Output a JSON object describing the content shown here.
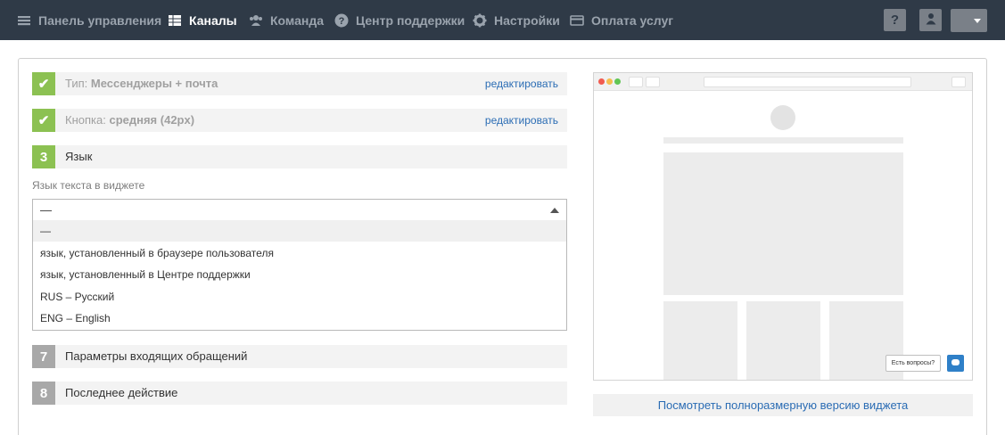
{
  "nav": {
    "items": [
      {
        "label": "Панель управления",
        "icon": "dashboard-icon",
        "active": false
      },
      {
        "label": "Каналы",
        "icon": "channels-icon",
        "active": true
      },
      {
        "label": "Команда",
        "icon": "team-icon",
        "active": false
      },
      {
        "label": "Центр поддержки",
        "icon": "help-circle-icon",
        "active": false
      },
      {
        "label": "Настройки",
        "icon": "gear-icon",
        "active": false
      },
      {
        "label": "Оплата услуг",
        "icon": "credit-card-icon",
        "active": false
      }
    ],
    "help_label": "?",
    "colors": {
      "bar": "#2f3a47",
      "inactive": "#9aa3ad",
      "active": "#ffffff"
    }
  },
  "steps": [
    {
      "badge": "✔",
      "label": "Тип:",
      "value": "Мессенджеры + почта",
      "edit": "редактировать",
      "state": "done"
    },
    {
      "badge": "✔",
      "label": "Кнопка:",
      "value": "средняя (42px)",
      "edit": "редактировать",
      "state": "done"
    },
    {
      "badge": "3",
      "label": "Язык",
      "state": "current"
    },
    {
      "badge": "7",
      "label": "Параметры входящих обращений",
      "state": "todo"
    },
    {
      "badge": "8",
      "label": "Последнее действие",
      "state": "todo"
    }
  ],
  "language": {
    "field_label": "Язык текста в виджете",
    "selected": "—",
    "options": [
      "—",
      "язык, установленный в браузере пользователя",
      "язык, установленный в Центре поддержки",
      "RUS – Русский",
      "ENG – English"
    ]
  },
  "preview": {
    "ask_button": "Есть вопросы?",
    "full_link": "Посмотреть полноразмерную версию виджета"
  },
  "colors": {
    "accent_green": "#8cc152",
    "link_blue": "#2a6cb4",
    "chat_blue": "#2f80c8"
  }
}
